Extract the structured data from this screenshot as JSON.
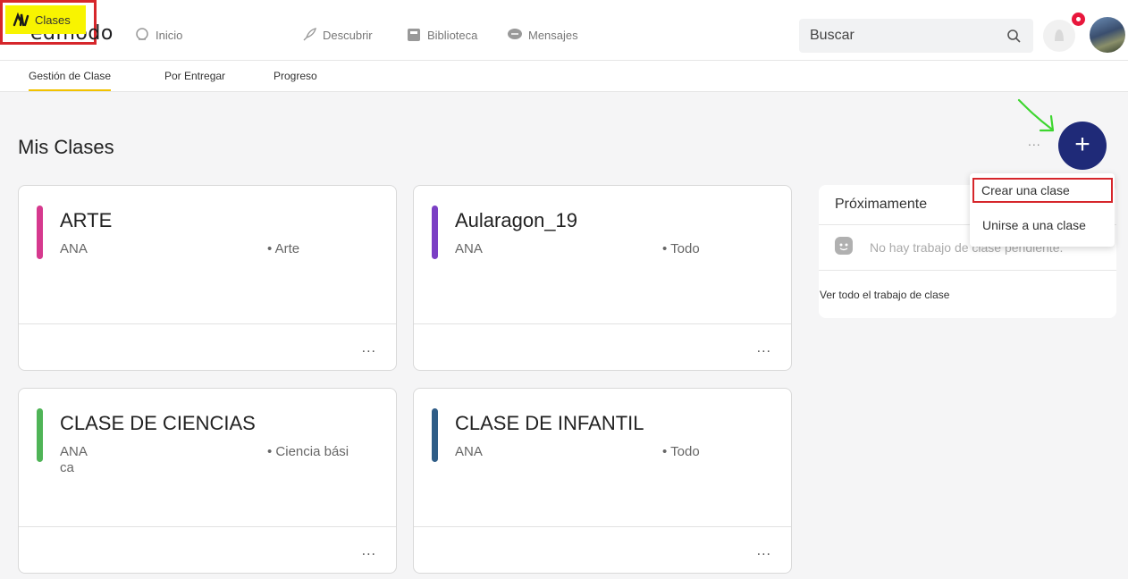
{
  "brand": "edmodo",
  "nav": {
    "inicio": "Inicio",
    "clases": "Clases",
    "descubrir": "Descubrir",
    "biblioteca": "Biblioteca",
    "mensajes": "Mensajes"
  },
  "search": {
    "placeholder": "Buscar"
  },
  "subnav": {
    "gestion": "Gestión de Clase",
    "por_entregar": "Por Entregar",
    "progreso": "Progreso"
  },
  "page_title": "Mis Clases",
  "classes": [
    {
      "title": "ARTE",
      "owner": "ANA",
      "subject": "• Arte",
      "color": "#d6398e"
    },
    {
      "title": "Aularagon_19",
      "owner": "ANA",
      "subject": "• Todo",
      "color": "#7b3fc4"
    },
    {
      "title": "CLASE DE CIENCIAS",
      "owner": "ANA",
      "subject": "• Ciencia bási",
      "subject_cont": "ca",
      "color": "#4fb457"
    },
    {
      "title": "CLASE DE INFANTIL",
      "owner": "ANA",
      "subject": "• Todo",
      "color": "#2f5d87"
    }
  ],
  "card_menu": "...",
  "fab_more": "...",
  "fab_label": "+",
  "panel": {
    "title": "Próximamente",
    "empty": "No hay trabajo de clase pendiente.",
    "see_all": "Ver todo el trabajo de clase"
  },
  "dropdown": {
    "create": "Crear una clase",
    "join": "Unirse a una clase"
  },
  "colors": {
    "highlight_box": "#d6262b",
    "highlight_fill": "#f8f400",
    "fab": "#1f2a78",
    "notification": "#e8173c"
  }
}
